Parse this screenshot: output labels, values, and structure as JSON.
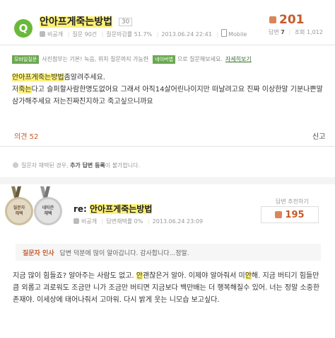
{
  "question": {
    "badge": "Q",
    "title": "안아프게죽는방법",
    "level": "30",
    "author": "비공개",
    "meta_items": [
      "질문 90건",
      "질문마감률 51.7%",
      "2013.06.24 22:41"
    ],
    "device": "Mobile",
    "votes": "201",
    "answers_label": "답변",
    "answers_count": "7",
    "views_label": "조회",
    "views_count": "1,012"
  },
  "notice": {
    "badge": "모바일질문",
    "text1": "사진첨부는 기본! 녹음, 위치 질문까지 가능한",
    "badge2": "네이버앱",
    "text2": "으로 질문해보세요.",
    "link": "자세히보기"
  },
  "body": {
    "line1_hl": "안아프게죽는방법",
    "line1_rest": "좀알려주세요.",
    "line2_pre": "저",
    "line2_hl": "죽는",
    "line2_rest": "다고 슬퍼할사람한명도없어요 그래서 아직14살어린나이지만 떠날려고요 진짜 이상한말 기분나쁜말",
    "line3": "삼가해주세요 저는진짜진지하고 죽고싶으니까요"
  },
  "actions": {
    "opinion": "의견 52",
    "report": "신고"
  },
  "hint": {
    "pre": "질문자 채택된 경우,",
    "bold": "추가 답변 등록",
    "post": "이 불가합니다."
  },
  "answer": {
    "medal1": [
      "질문자",
      "채택"
    ],
    "medal2": [
      "네티즌",
      "채택"
    ],
    "prefix": "re:",
    "title": "안아프게죽는방법",
    "author": "비공개",
    "meta_items": [
      "답변채택률 0%",
      "2013.06.24 23:09"
    ],
    "recommend_label": "답변 추천하기",
    "recommend_count": "195",
    "thanks_label": "질문자 인사",
    "thanks_text": "답변 덕분에 많이 알아갑니다. 감사합니다...정말.",
    "text_p1": "지금 많이 힘들죠? 알아주는 사람도 없고.",
    "text_hl1": "안",
    "text_p2": "괜찮은거 알아. 이제야 알아줘서 미",
    "text_hl2": "안",
    "text_p3": "해. 지금 버티기 힘들만큼 외롭고 괴로워도 조금만 니가 조금만 버티면 지금보다 백만배는 더 행복해질수 있어. 너는 정말 소중한 존재야. 이세상에 태어나줘서 고마워. 다시 밝게 웃는 니모습 보고싶다."
  },
  "colors": {
    "accent_green": "#6bb83a",
    "accent_orange": "#c65a2b",
    "highlight": "#fcf17a"
  }
}
